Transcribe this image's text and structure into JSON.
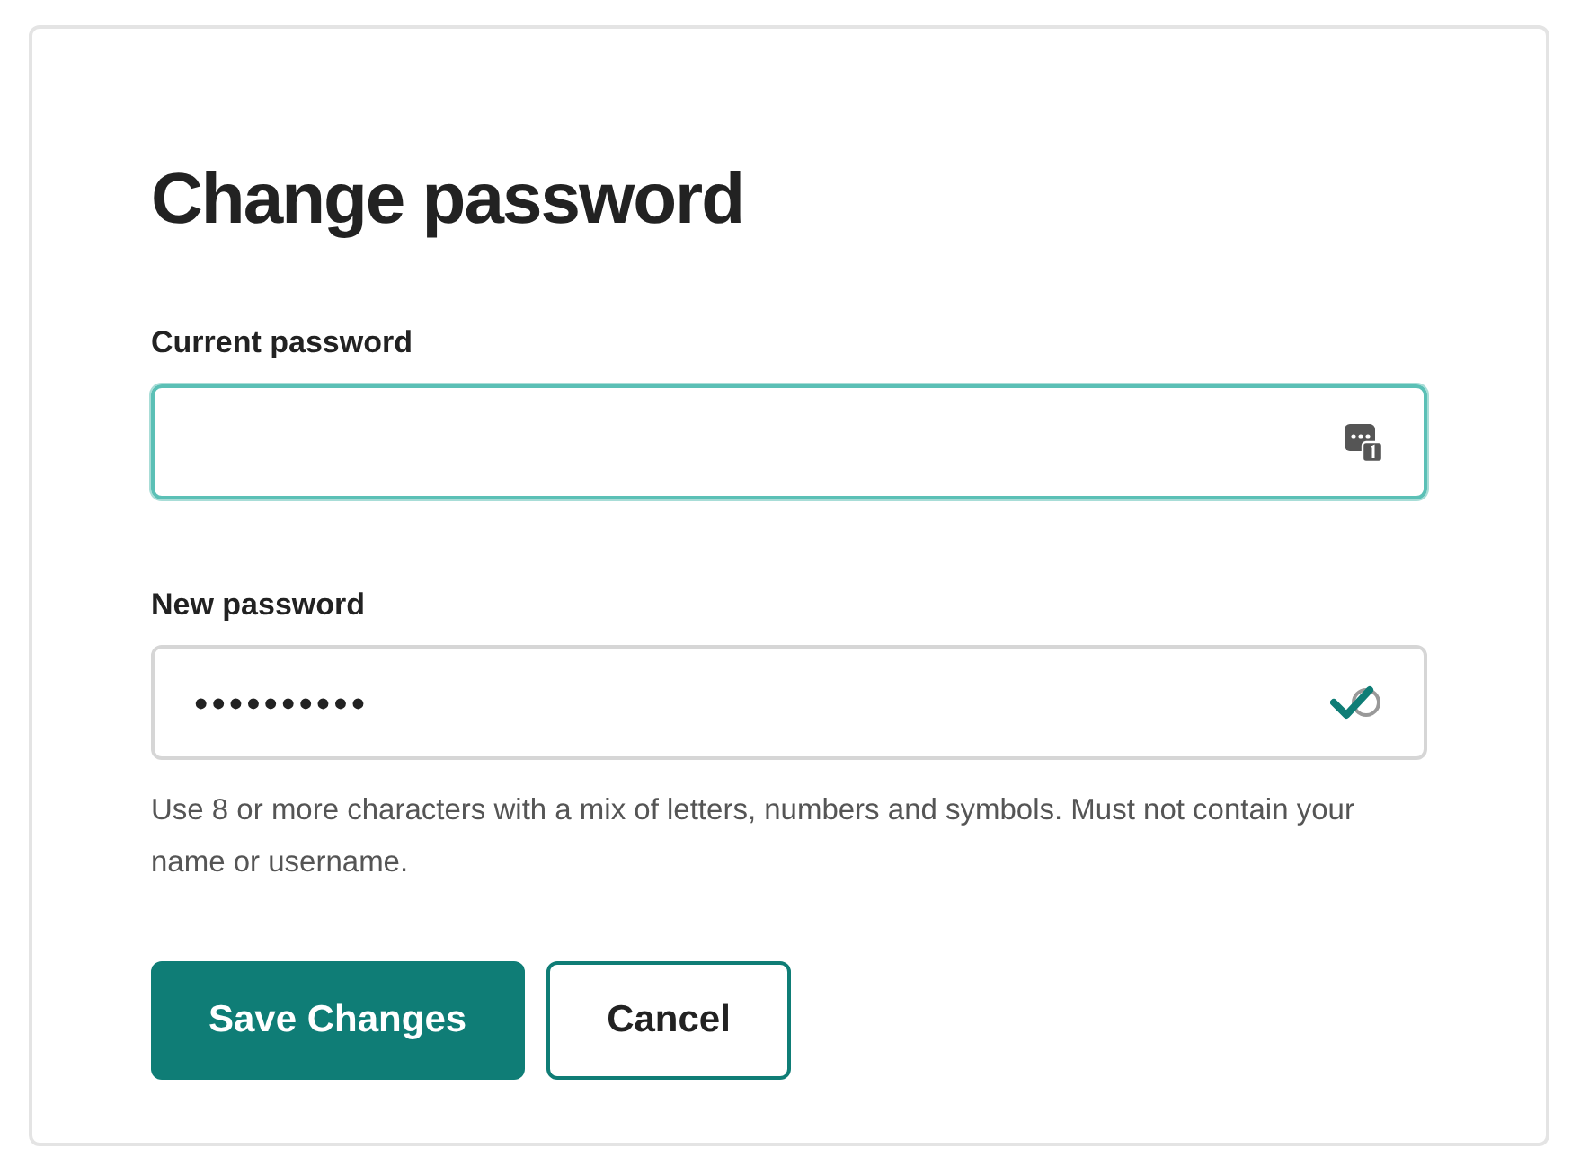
{
  "title": "Change password",
  "fields": [
    {
      "label": "Current password",
      "focused": true,
      "kind": "autofill"
    },
    {
      "label": "New password",
      "value": "••••••••••",
      "focused": false,
      "kind": "verified"
    }
  ],
  "hint": "Use 8 or more characters with a mix of letters, numbers and symbols. Must not contain your name or username.",
  "buttons": [
    {
      "label": "Save Changes",
      "kind": "primary"
    },
    {
      "label": "Cancel",
      "kind": "secondary"
    }
  ]
}
